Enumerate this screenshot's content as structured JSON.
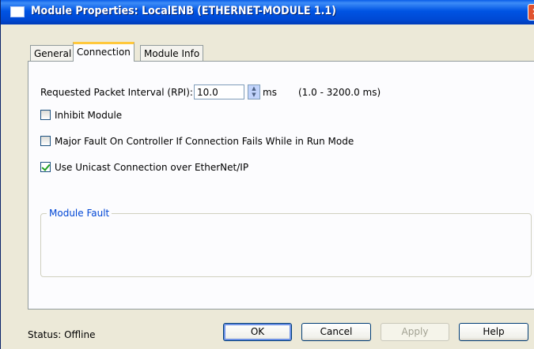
{
  "window": {
    "title": "Module Properties: LocalENB (ETHERNET-MODULE 1.1)",
    "close_glyph": "✕"
  },
  "tabs": [
    {
      "label": "General",
      "active": false
    },
    {
      "label": "Connection",
      "active": true
    },
    {
      "label": "Module Info",
      "active": false
    }
  ],
  "connection": {
    "rpi_label": "Requested Packet Interval (RPI):",
    "rpi_value": "10.0",
    "rpi_unit": "ms",
    "rpi_range": "(1.0 - 3200.0 ms)",
    "inhibit_label": "Inhibit Module",
    "inhibit_checked": false,
    "major_fault_label": "Major Fault On Controller If Connection Fails While in Run Mode",
    "major_fault_checked": false,
    "unicast_label": "Use Unicast Connection over EtherNet/IP",
    "unicast_checked": true
  },
  "module_fault": {
    "legend": "Module Fault"
  },
  "footer": {
    "status": "Status:  Offline",
    "ok_label": "OK",
    "cancel_label": "Cancel",
    "apply_label": "Apply",
    "help_label": "Help"
  },
  "colors": {
    "titlebar": "#0054e3",
    "dialog_bg": "#ece9d8",
    "active_tab_accent": "#ffc83c",
    "group_legend": "#0046d5",
    "checkmark": "#21a121"
  },
  "icons": [
    "window-icon",
    "close-icon",
    "spin-up-icon",
    "spin-down-icon",
    "checkmark-icon"
  ]
}
